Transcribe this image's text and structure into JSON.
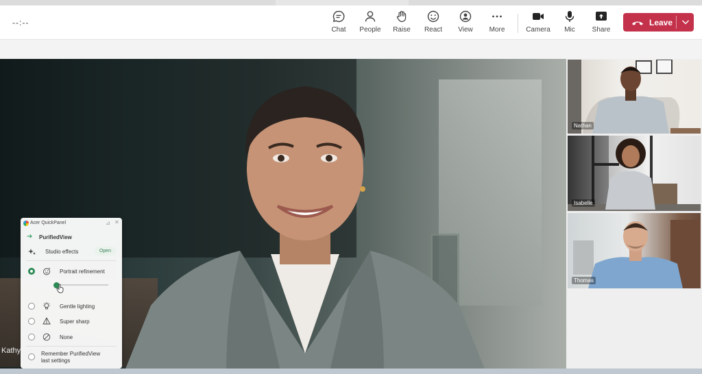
{
  "meeting": {
    "timer": "--:--",
    "toolbar": [
      {
        "key": "chat",
        "label": "Chat",
        "icon": "chat-icon"
      },
      {
        "key": "people",
        "label": "People",
        "icon": "people-icon"
      },
      {
        "key": "raise",
        "label": "Raise",
        "icon": "raise-hand-icon"
      },
      {
        "key": "react",
        "label": "React",
        "icon": "react-icon"
      },
      {
        "key": "view",
        "label": "View",
        "icon": "view-icon"
      },
      {
        "key": "more",
        "label": "More",
        "icon": "more-icon"
      },
      {
        "key": "camera",
        "label": "Camera",
        "icon": "camera-icon"
      },
      {
        "key": "mic",
        "label": "Mic",
        "icon": "mic-icon"
      },
      {
        "key": "share",
        "label": "Share",
        "icon": "share-icon"
      }
    ],
    "leave_label": "Leave",
    "leave_color": "#c4314b"
  },
  "main_video": {
    "name": "Kathy"
  },
  "participants": [
    {
      "name": "Nathan"
    },
    {
      "name": "Isabelle"
    },
    {
      "name": "Thomas"
    }
  ],
  "quick_panel": {
    "title": "Acer QuickPanel",
    "section": "PurifiedView",
    "studio_effects": "Studio effects",
    "open_label": "Open",
    "options": [
      {
        "label": "Portrait refinement",
        "selected": true
      },
      {
        "label": "Gentle lighting",
        "selected": false
      },
      {
        "label": "Super sharp",
        "selected": false
      },
      {
        "label": "None",
        "selected": false
      }
    ],
    "slider_value": 0.0,
    "remember_line1": "Remember PurifiedView",
    "remember_line2": "last settings",
    "accent_color": "#2e8b57"
  }
}
